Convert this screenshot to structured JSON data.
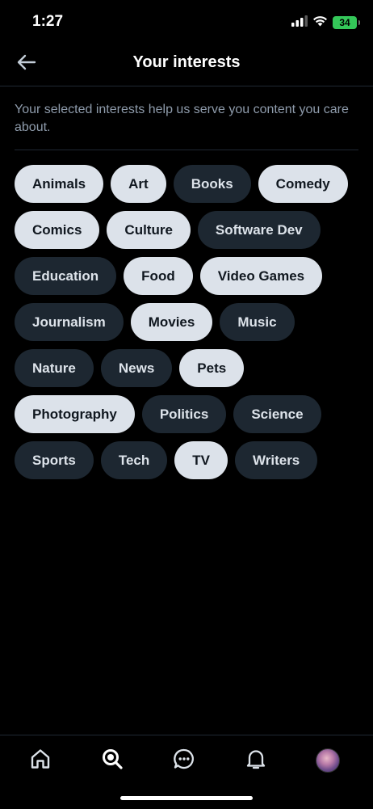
{
  "status_bar": {
    "time": "1:27",
    "battery": "34"
  },
  "header": {
    "title": "Your interests"
  },
  "description": "Your selected interests help us serve you content you care about.",
  "chips": [
    {
      "label": "Animals",
      "selected": true
    },
    {
      "label": "Art",
      "selected": true
    },
    {
      "label": "Books",
      "selected": false
    },
    {
      "label": "Comedy",
      "selected": true
    },
    {
      "label": "Comics",
      "selected": true
    },
    {
      "label": "Culture",
      "selected": true
    },
    {
      "label": "Software Dev",
      "selected": false
    },
    {
      "label": "Education",
      "selected": false
    },
    {
      "label": "Food",
      "selected": true
    },
    {
      "label": "Video Games",
      "selected": true
    },
    {
      "label": "Journalism",
      "selected": false
    },
    {
      "label": "Movies",
      "selected": true
    },
    {
      "label": "Music",
      "selected": false
    },
    {
      "label": "Nature",
      "selected": false
    },
    {
      "label": "News",
      "selected": false
    },
    {
      "label": "Pets",
      "selected": true
    },
    {
      "label": "Photography",
      "selected": true
    },
    {
      "label": "Politics",
      "selected": false
    },
    {
      "label": "Science",
      "selected": false
    },
    {
      "label": "Sports",
      "selected": false
    },
    {
      "label": "Tech",
      "selected": false
    },
    {
      "label": "TV",
      "selected": true
    },
    {
      "label": "Writers",
      "selected": false
    }
  ],
  "bottom_nav": {
    "items": [
      {
        "icon": "home-icon"
      },
      {
        "icon": "search-icon",
        "active": true
      },
      {
        "icon": "chat-icon"
      },
      {
        "icon": "bell-icon"
      },
      {
        "icon": "avatar"
      }
    ]
  },
  "colors": {
    "background": "#000000",
    "chip_selected_bg": "#dce2ea",
    "chip_unselected_bg": "#1d2731",
    "description_text": "#8e9bab",
    "battery": "#34c759"
  }
}
